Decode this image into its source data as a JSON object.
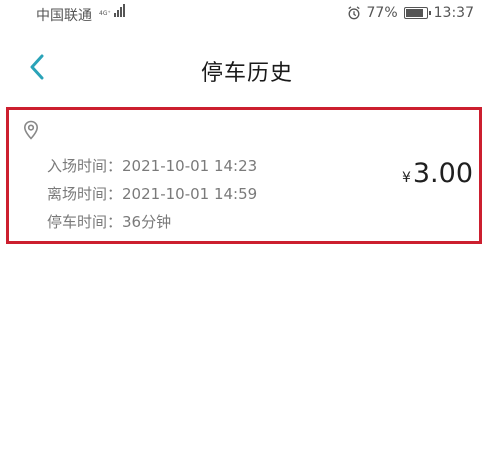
{
  "status_bar": {
    "carrier": "中国联通",
    "signal_label": "4G⁺",
    "battery": "77%",
    "time": "13:37"
  },
  "header": {
    "title": "停车历史",
    "back_icon": "chevron-left-icon"
  },
  "record": {
    "location_icon": "location-pin-icon",
    "entry_label": "入场时间：",
    "entry_time": "2021-10-01 14:23",
    "exit_label": "离场时间：",
    "exit_time": "2021-10-01 14:59",
    "duration_label": "停车时间：",
    "duration": "36分钟",
    "currency": "¥",
    "amount": "3.00"
  },
  "colors": {
    "accent": "#2aa3b8",
    "highlight_border": "#cc1f2f"
  }
}
